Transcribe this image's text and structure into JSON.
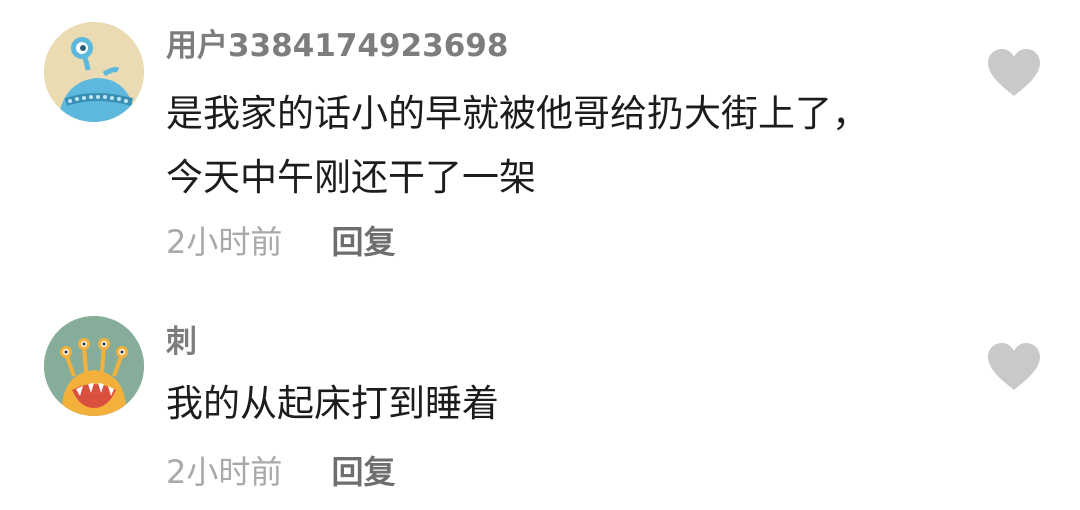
{
  "comments": [
    {
      "username": "用户3384174923698",
      "text_lines": [
        "是我家的话小的早就被他哥给扔大街上了，",
        "今天中午刚还干了一架"
      ],
      "time": "2小时前",
      "reply_label": "回复",
      "avatar_icon": "blue-alien-avatar-icon",
      "like_icon": "heart-icon"
    },
    {
      "username": "刺",
      "text_lines": [
        "我的从起床打到睡着"
      ],
      "time": "2小时前",
      "reply_label": "回复",
      "avatar_icon": "orange-monster-avatar-icon",
      "like_icon": "heart-icon"
    }
  ],
  "colors": {
    "username": "#7d7d7d",
    "text": "#1c1c1c",
    "time": "#a9a9a9",
    "reply": "#6e6e6e",
    "heart": "#c9c9c9"
  }
}
